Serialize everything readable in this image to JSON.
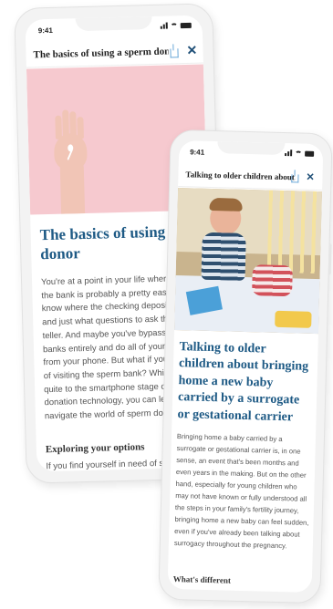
{
  "phone_back": {
    "status_time": "9:41",
    "nav_title": "The basics of using a sperm donor",
    "headline": "The basics of using a sperm donor",
    "body_lines": [
      "You're at a point in your life where",
      "the bank is probably a pretty easy t",
      "know where the checking deposit s",
      "and just what questions to ask the l",
      "teller. And maybe you've bypassed",
      "banks entirely and do all of your ba",
      "from your phone. But what if you're",
      "of visiting the sperm bank? While w",
      "quite to the smartphone stage of sp",
      "donation technology, you can learn",
      "navigate the world of sperm donati"
    ],
    "subhead": "Exploring your options",
    "after_subhead": "If you find yourself in need of sperm"
  },
  "phone_front": {
    "status_time": "9:41",
    "nav_title": "Talking to older children about...",
    "headline": "Talking to older children about bringing home a new baby carried by a surrogate or gestational carrier",
    "body_lines": [
      "Bringing home a baby carried by a",
      "surrogate or gestational carrier is, in one",
      "sense, an event that's been months and",
      "even years in the making. But on the other",
      "hand, especially for young children who",
      "may not have known or fully understood all",
      "the steps in your family's fertility journey,",
      "bringing home a new baby can feel sudden,",
      "even if you've already been talking about",
      "surrogacy throughout the pregnancy."
    ],
    "subhead": "What's different"
  },
  "colors": {
    "accent": "#1e5a85",
    "pink_bg": "#f6c9cf",
    "frame": "#f3f3f3"
  },
  "icons": [
    "share-icon",
    "close-icon",
    "signal-icon",
    "wifi-icon",
    "battery-icon"
  ]
}
